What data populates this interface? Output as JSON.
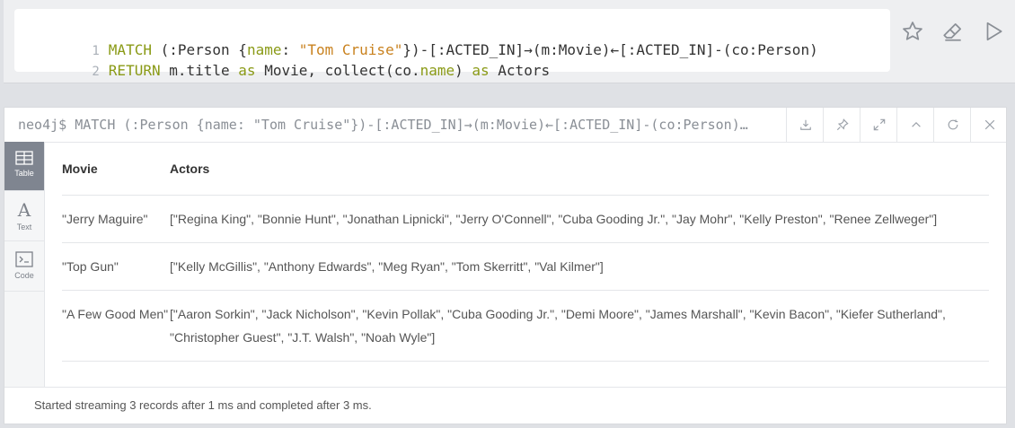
{
  "editor": {
    "line1": {
      "num": "1",
      "p1": "MATCH",
      "p2": " (:Person {",
      "p3": "name",
      "p4": ": ",
      "p5": "\"Tom Cruise\"",
      "p6": "})-[:ACTED_IN]→(m:Movie)←[:ACTED_IN]-(co:Person)"
    },
    "line2": {
      "num": "2",
      "p1": "RETURN",
      "p2": " m.title ",
      "p3": "as",
      "p4": " Movie, collect(co.",
      "p5": "name",
      "p6": ") ",
      "p7": "as",
      "p8": " Actors"
    },
    "actions": [
      "star-icon",
      "eraser-icon",
      "play-icon"
    ]
  },
  "result": {
    "query_preview": "neo4j$ MATCH (:Person {name: \"Tom Cruise\"})-[:ACTED_IN]→(m:Movie)←[:ACTED_IN]-(co:Person)…",
    "header_actions": [
      "download-icon",
      "pin-icon",
      "expand-icon",
      "collapse-icon",
      "rerun-icon",
      "close-icon"
    ],
    "tabs": [
      {
        "label": "Table",
        "icon": "table-icon",
        "active": true
      },
      {
        "label": "Text",
        "icon": "text-icon",
        "active": false
      },
      {
        "label": "Code",
        "icon": "code-icon",
        "active": false
      }
    ],
    "columns": [
      "Movie",
      "Actors"
    ],
    "rows": [
      {
        "movie": "\"Jerry Maguire\"",
        "actors": "[\"Regina King\", \"Bonnie Hunt\", \"Jonathan Lipnicki\", \"Jerry O'Connell\", \"Cuba Gooding Jr.\", \"Jay Mohr\", \"Kelly Preston\", \"Renee Zellweger\"]"
      },
      {
        "movie": "\"Top Gun\"",
        "actors": "[\"Kelly McGillis\", \"Anthony Edwards\", \"Meg Ryan\", \"Tom Skerritt\", \"Val Kilmer\"]"
      },
      {
        "movie": "\"A Few Good Men\"",
        "actors": "[\"Aaron Sorkin\", \"Jack Nicholson\", \"Kevin Pollak\", \"Cuba Gooding Jr.\", \"Demi Moore\", \"James Marshall\", \"Kevin Bacon\", \"Kiefer Sutherland\", \"Christopher Guest\", \"J.T. Walsh\", \"Noah Wyle\"]"
      }
    ],
    "status": "Started streaming 3 records after 1 ms and completed after 3 ms."
  }
}
